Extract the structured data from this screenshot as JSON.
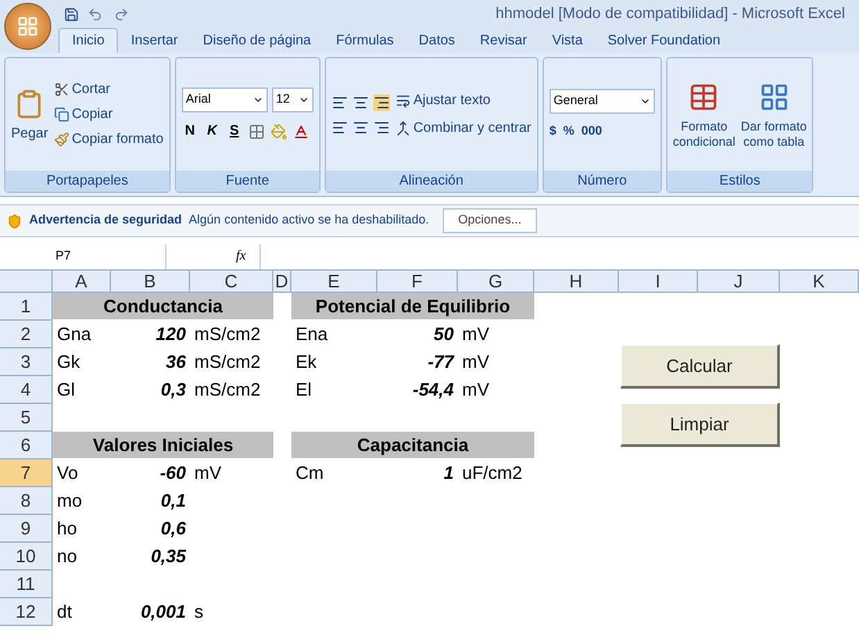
{
  "window": {
    "title": "hhmodel  [Modo de compatibilidad] - Microsoft Excel"
  },
  "tabs": [
    {
      "label": "Inicio",
      "selected": true
    },
    {
      "label": "Insertar",
      "selected": false
    },
    {
      "label": "Diseño de página",
      "selected": false
    },
    {
      "label": "Fórmulas",
      "selected": false
    },
    {
      "label": "Datos",
      "selected": false
    },
    {
      "label": "Revisar",
      "selected": false
    },
    {
      "label": "Vista",
      "selected": false
    },
    {
      "label": "Solver Foundation",
      "selected": false
    }
  ],
  "ribbon": {
    "clipboard": {
      "label": "Portapapeles",
      "paste": "Pegar",
      "cut": "Cortar",
      "copy": "Copiar",
      "format_painter": "Copiar formato"
    },
    "font": {
      "label": "Fuente",
      "name": "Arial",
      "size": "12",
      "bold": "N",
      "italic": "K",
      "underline": "S"
    },
    "alignment": {
      "label": "Alineación",
      "wrap": "Ajustar texto",
      "merge": "Combinar y centrar"
    },
    "number": {
      "label": "Número",
      "format": "General",
      "currency": "$",
      "percent": "%",
      "thousands": "000"
    },
    "styles": {
      "label": "Estilos",
      "conditional": [
        "Formato",
        "condicional"
      ],
      "table": [
        "Dar formato",
        "como tabla"
      ]
    }
  },
  "security_bar": {
    "title": "Advertencia de seguridad",
    "message": "Algún contenido activo se ha deshabilitado.",
    "button": "Opciones..."
  },
  "formula_bar": {
    "name_box": "P7",
    "fx": "fx"
  },
  "columns": [
    "A",
    "B",
    "C",
    "D",
    "E",
    "F",
    "G",
    "H",
    "I",
    "J",
    "K"
  ],
  "rows": [
    {
      "number": "1",
      "selected": false,
      "kind": "header",
      "left": {
        "title": "Conductancia"
      },
      "right": {
        "title": "Potencial de Equilibrio"
      }
    },
    {
      "number": "2",
      "selected": false,
      "kind": "data",
      "left": {
        "label": "Gna",
        "value": "120",
        "unit": "mS/cm2"
      },
      "right": {
        "label": "Ena",
        "value": "50",
        "unit": "mV"
      }
    },
    {
      "number": "3",
      "selected": false,
      "kind": "data",
      "left": {
        "label": "Gk",
        "value": "36",
        "unit": "mS/cm2"
      },
      "right": {
        "label": "Ek",
        "value": "-77",
        "unit": "mV"
      }
    },
    {
      "number": "4",
      "selected": false,
      "kind": "data",
      "left": {
        "label": "Gl",
        "value": "0,3",
        "unit": "mS/cm2"
      },
      "right": {
        "label": "El",
        "value": "-54,4",
        "unit": "mV"
      }
    },
    {
      "number": "5",
      "selected": false,
      "kind": "data"
    },
    {
      "number": "6",
      "selected": false,
      "kind": "header",
      "left": {
        "title": "Valores Iniciales"
      },
      "right": {
        "title": "Capacitancia"
      }
    },
    {
      "number": "7",
      "selected": true,
      "kind": "data",
      "left": {
        "label": "Vo",
        "value": "-60",
        "unit": "mV"
      },
      "right": {
        "label": "Cm",
        "value": "1",
        "unit": "uF/cm2"
      }
    },
    {
      "number": "8",
      "selected": false,
      "kind": "data",
      "left": {
        "label": "mo",
        "value": "0,1"
      }
    },
    {
      "number": "9",
      "selected": false,
      "kind": "data",
      "left": {
        "label": "ho",
        "value": "0,6"
      }
    },
    {
      "number": "10",
      "selected": false,
      "kind": "data",
      "left": {
        "label": "no",
        "value": "0,35"
      }
    },
    {
      "number": "11",
      "selected": false,
      "kind": "data"
    },
    {
      "number": "12",
      "selected": false,
      "kind": "data",
      "left": {
        "label": "dt",
        "value": "0,001",
        "unit": "s"
      }
    }
  ],
  "buttons": [
    "Calcular",
    "Limpiar"
  ]
}
